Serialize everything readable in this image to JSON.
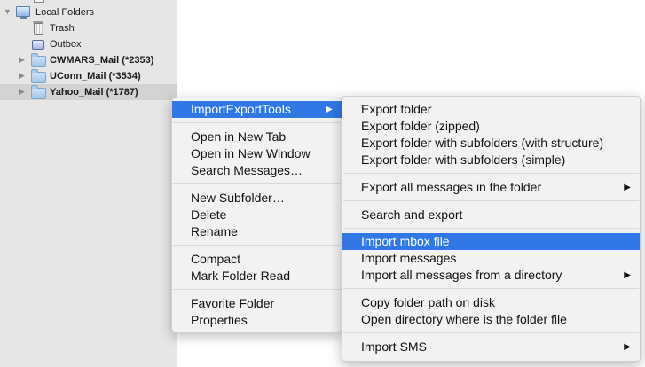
{
  "sidebar": {
    "account": "Local Folders",
    "folders": [
      {
        "label": "Trash",
        "icon": "trash-icon"
      },
      {
        "label": "Outbox",
        "icon": "outbox-icon"
      },
      {
        "label": "CWMARS_Mail (*2353)",
        "icon": "folder-icon"
      },
      {
        "label": "UConn_Mail (*3534)",
        "icon": "folder-icon"
      },
      {
        "label": "Yahoo_Mail (*1787)",
        "icon": "folder-icon"
      }
    ]
  },
  "context_menu": {
    "items": [
      {
        "label": "ImportExportTools"
      },
      {
        "label": "Open in New Tab"
      },
      {
        "label": "Open in New Window"
      },
      {
        "label": "Search Messages…"
      },
      {
        "label": "New Subfolder…"
      },
      {
        "label": "Delete"
      },
      {
        "label": "Rename"
      },
      {
        "label": "Compact"
      },
      {
        "label": "Mark Folder Read"
      },
      {
        "label": "Favorite Folder"
      },
      {
        "label": "Properties"
      }
    ]
  },
  "submenu": {
    "items": [
      {
        "label": "Export folder"
      },
      {
        "label": "Export folder (zipped)"
      },
      {
        "label": "Export folder with subfolders (with structure)"
      },
      {
        "label": "Export folder with subfolders (simple)"
      },
      {
        "label": "Export all messages in the folder"
      },
      {
        "label": "Search and export"
      },
      {
        "label": "Import mbox file"
      },
      {
        "label": "Import messages"
      },
      {
        "label": "Import all messages from a directory"
      },
      {
        "label": "Copy folder path on disk"
      },
      {
        "label": "Open directory where is the folder file"
      },
      {
        "label": "Import SMS"
      }
    ]
  },
  "glyphs": {
    "submenu_arrow": "▶",
    "expand_open": "▼",
    "expand_closed": "▶"
  },
  "colors": {
    "highlight": "#2f78e6",
    "sidebar_bg": "#e6e6e6",
    "selected_row": "#d3d3d3"
  }
}
